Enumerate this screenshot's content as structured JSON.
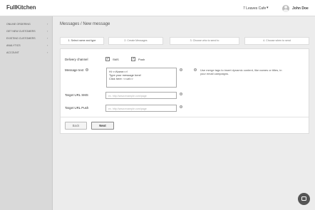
{
  "header": {
    "logo": "FullKitchen",
    "venue": "7 Leaves Cafe",
    "venue_caret": "▾",
    "user_name": "John Doe"
  },
  "sidebar": {
    "items": [
      {
        "label": "Online Ordering",
        "arrow": "›"
      },
      {
        "label": "Get New Customers",
        "arrow": "›"
      },
      {
        "label": "Existing Customers",
        "arrow": "›"
      },
      {
        "label": "Analytics",
        "arrow": "›"
      },
      {
        "label": "Account",
        "arrow": "›"
      }
    ]
  },
  "page": {
    "title": "Messages / New message"
  },
  "steps": [
    {
      "label": "1. Select name and type"
    },
    {
      "label": "2. Create Messages"
    },
    {
      "label": "3. Choose who to send to"
    },
    {
      "label": "4. Choose when to send"
    }
  ],
  "form": {
    "delivery_label": "Delivery channel",
    "sms_label": "SMS",
    "sms_checked": "✓",
    "push_label": "Push",
    "push_checked": "✓",
    "message_label": "Message text",
    "help_glyph": "?",
    "message_lines": [
      "Hi <<Name>>!",
      "Type your message here!",
      "Click here: <<url>>"
    ],
    "hint_text": "Use merge tags to insert dynamic content, like names or titles, in your email campaigns.",
    "sms_url_label": "Target URL SMS",
    "sms_url_placeholder": "ex. http://www.example.com/page",
    "push_url_label": "Target URL Push",
    "push_url_placeholder": "ex. http://www.example.com/page"
  },
  "buttons": {
    "back": "Back",
    "next": "Next"
  }
}
